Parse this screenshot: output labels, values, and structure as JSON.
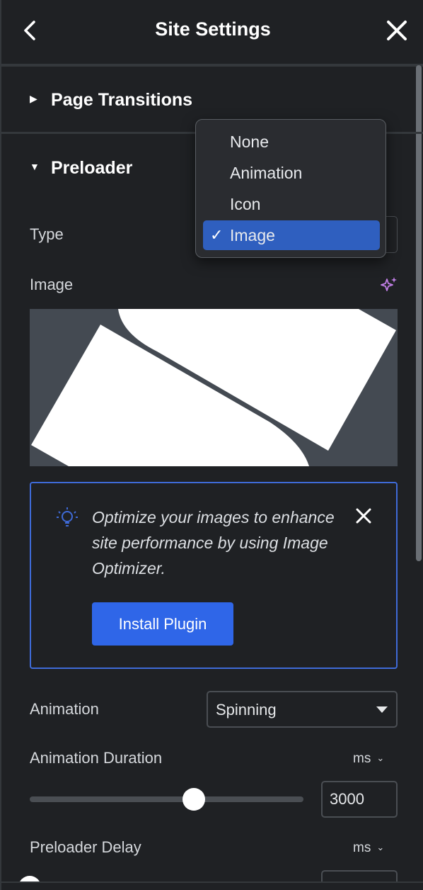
{
  "header": {
    "title": "Site Settings"
  },
  "sections": {
    "page_transitions": {
      "label": "Page Transitions"
    },
    "preloader": {
      "label": "Preloader"
    }
  },
  "type_field": {
    "label": "Type",
    "options": [
      "None",
      "Animation",
      "Icon",
      "Image"
    ],
    "selected": "Image"
  },
  "image_field": {
    "label": "Image"
  },
  "notice": {
    "message": "Optimize your images to enhance site performance by using Image Optimizer.",
    "button_label": "Install Plugin"
  },
  "animation_field": {
    "label": "Animation",
    "value": "Spinning"
  },
  "animation_duration": {
    "label": "Animation Duration",
    "unit": "ms",
    "value": "3000"
  },
  "preloader_delay": {
    "label": "Preloader Delay",
    "unit": "ms"
  },
  "colors": {
    "accent": "#2f66e8",
    "selected_option": "#2f5fbf",
    "panel_bg": "#1f2124",
    "sparkle": "#c27fe8"
  }
}
